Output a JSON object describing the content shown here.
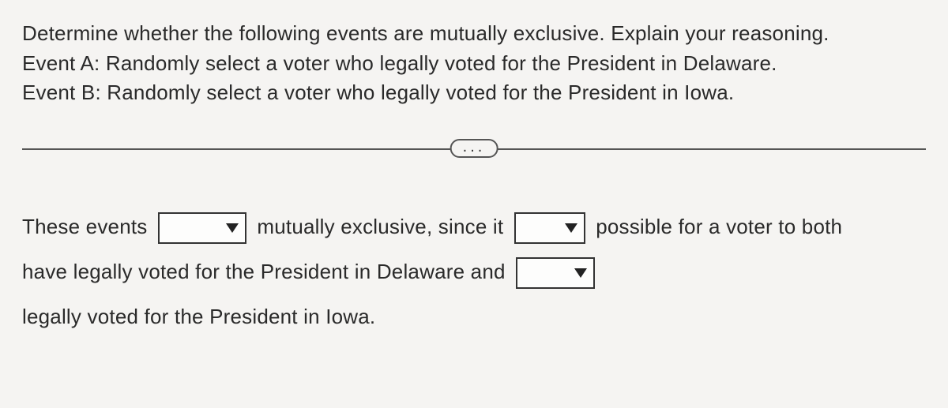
{
  "prompt": {
    "line1": "Determine whether the following events are mutually exclusive. Explain your reasoning.",
    "line2": "Event A: Randomly select a voter who legally voted for the President in Delaware.",
    "line3": "Event B: Randomly select a voter who legally voted for the President in Iowa."
  },
  "divider": {
    "pill_label": "..."
  },
  "answer": {
    "seg1": "These events",
    "seg2": "mutually exclusive, since it",
    "seg3": "possible for a voter to both",
    "seg4": "have legally voted for the President in Delaware and",
    "seg5": "legally voted for the President in Iowa."
  },
  "dropdowns": {
    "d1_value": "",
    "d2_value": "",
    "d3_value": ""
  }
}
